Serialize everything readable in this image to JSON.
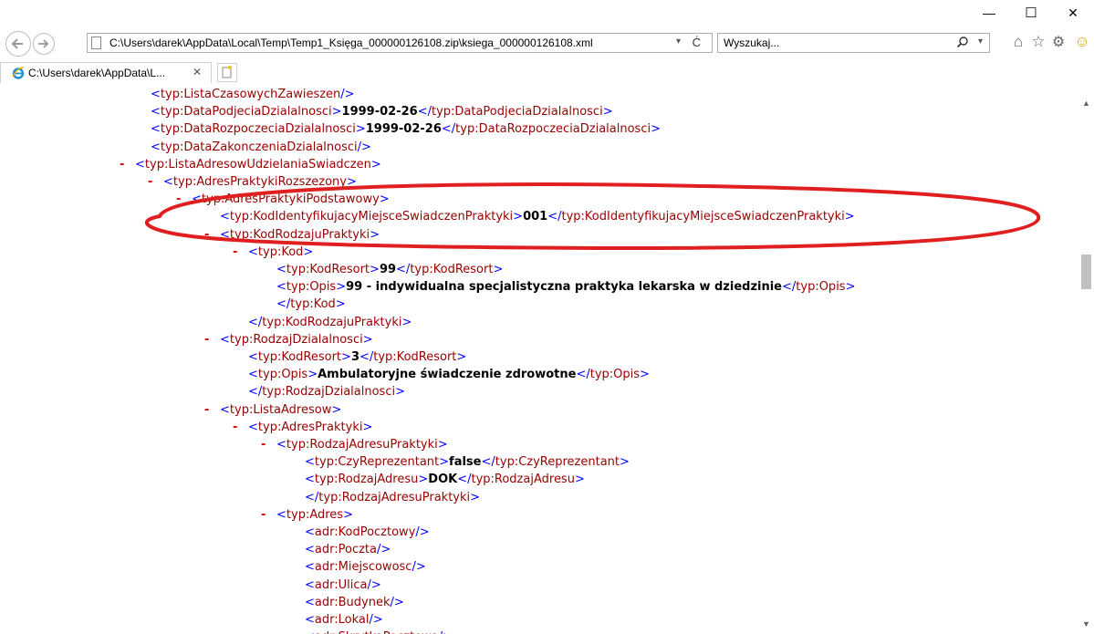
{
  "window": {
    "minimize_glyph": "—",
    "maximize_glyph": "☐",
    "close_glyph": "✕"
  },
  "toolbar": {
    "address": "C:\\Users\\darek\\AppData\\Local\\Temp\\Temp1_Księga_000000126108.zip\\ksiega_000000126108.xml",
    "address_dropdown": "▾",
    "refresh_glyph": "Ċ",
    "search_placeholder": "Wyszukaj...",
    "search_dropdown": "▾",
    "home_glyph": "⌂",
    "favorites_glyph": "☆",
    "settings_glyph": "⚙",
    "smiley_glyph": "☺"
  },
  "tabs": [
    {
      "title": "C:\\Users\\darek\\AppData\\L...",
      "close": "✕"
    }
  ],
  "xml_lines": [
    {
      "minus": "",
      "open": "typ:ListaCzasowychZawieszen",
      "value": "",
      "close": "",
      "selfclose": true
    },
    {
      "minus": "",
      "open": "typ:DataPodjeciaDzialalnosci",
      "value": "1999-02-26",
      "close": "typ:DataPodjeciaDzialalnosci",
      "selfclose": false
    },
    {
      "minus": "",
      "open": "typ:DataRozpoczeciaDzialalnosci",
      "value": "1999-02-26",
      "close": "typ:DataRozpoczeciaDzialalnosci",
      "selfclose": false
    },
    {
      "minus": "",
      "open": "typ:DataZakonczeniaDzialalnosci",
      "value": "",
      "close": "",
      "selfclose": true
    },
    {
      "minus": "-",
      "open": "typ:ListaAdresowUdzielaniaSwiadczen",
      "value": "",
      "close": "",
      "selfclose": false
    },
    {
      "minus": "-",
      "open": "typ:AdresPraktykiRozszezony",
      "value": "",
      "close": "",
      "selfclose": false
    },
    {
      "minus": "-",
      "open": "typ:AdresPraktykiPodstawowy",
      "value": "",
      "close": "",
      "selfclose": false
    },
    {
      "minus": "",
      "open": "typ:KodIdentyfikujacyMiejsceSwiadczenPraktyki",
      "value": "001",
      "close": "typ:KodIdentyfikujacyMiejsceSwiadczenPraktyki",
      "selfclose": false
    },
    {
      "minus": "-",
      "open": "typ:KodRodzajuPraktyki",
      "value": "",
      "close": "",
      "selfclose": false
    },
    {
      "minus": "-",
      "open": "typ:Kod",
      "value": "",
      "close": "",
      "selfclose": false
    },
    {
      "minus": "",
      "open": "typ:KodResort",
      "value": "99",
      "close": "typ:KodResort",
      "selfclose": false
    },
    {
      "minus": "",
      "open": "typ:Opis",
      "value": "99 - indywidualna specjalistyczna praktyka lekarska w dziedzinie",
      "close": "typ:Opis",
      "selfclose": false
    },
    {
      "minus": "",
      "open": "",
      "value": "",
      "close": "typ:Kod",
      "selfclose": false
    },
    {
      "minus": "",
      "open": "",
      "value": "",
      "close": "typ:KodRodzajuPraktyki",
      "selfclose": false
    },
    {
      "minus": "-",
      "open": "typ:RodzajDzialalnosci",
      "value": "",
      "close": "",
      "selfclose": false
    },
    {
      "minus": "",
      "open": "typ:KodResort",
      "value": "3",
      "close": "typ:KodResort",
      "selfclose": false
    },
    {
      "minus": "",
      "open": "typ:Opis",
      "value": "Ambulatoryjne świadczenie zdrowotne",
      "close": "typ:Opis",
      "selfclose": false
    },
    {
      "minus": "",
      "open": "",
      "value": "",
      "close": "typ:RodzajDzialalnosci",
      "selfclose": false
    },
    {
      "minus": "-",
      "open": "typ:ListaAdresow",
      "value": "",
      "close": "",
      "selfclose": false
    },
    {
      "minus": "-",
      "open": "typ:AdresPraktyki",
      "value": "",
      "close": "",
      "selfclose": false
    },
    {
      "minus": "-",
      "open": "typ:RodzajAdresuPraktyki",
      "value": "",
      "close": "",
      "selfclose": false
    },
    {
      "minus": "",
      "open": "typ:CzyReprezentant",
      "value": "false",
      "close": "typ:CzyReprezentant",
      "selfclose": false
    },
    {
      "minus": "",
      "open": "typ:RodzajAdresu",
      "value": "DOK",
      "close": "typ:RodzajAdresu",
      "selfclose": false
    },
    {
      "minus": "",
      "open": "",
      "value": "",
      "close": "typ:RodzajAdresuPraktyki",
      "selfclose": false
    },
    {
      "minus": "-",
      "open": "typ:Adres",
      "value": "",
      "close": "",
      "selfclose": false
    },
    {
      "minus": "",
      "open": "adr:KodPocztowy",
      "value": "",
      "close": "",
      "selfclose": true
    },
    {
      "minus": "",
      "open": "adr:Poczta",
      "value": "",
      "close": "",
      "selfclose": true
    },
    {
      "minus": "",
      "open": "adr:Miejscowosc",
      "value": "",
      "close": "",
      "selfclose": true
    },
    {
      "minus": "",
      "open": "adr:Ulica",
      "value": "",
      "close": "",
      "selfclose": true
    },
    {
      "minus": "",
      "open": "adr:Budynek",
      "value": "",
      "close": "",
      "selfclose": true
    },
    {
      "minus": "",
      "open": "adr:Lokal",
      "value": "",
      "close": "",
      "selfclose": true
    },
    {
      "minus": "",
      "open": "adr:SkrytkaPocztowa",
      "value": "",
      "close": "",
      "selfclose": true
    }
  ],
  "annotation": {
    "color": "#e02020"
  }
}
